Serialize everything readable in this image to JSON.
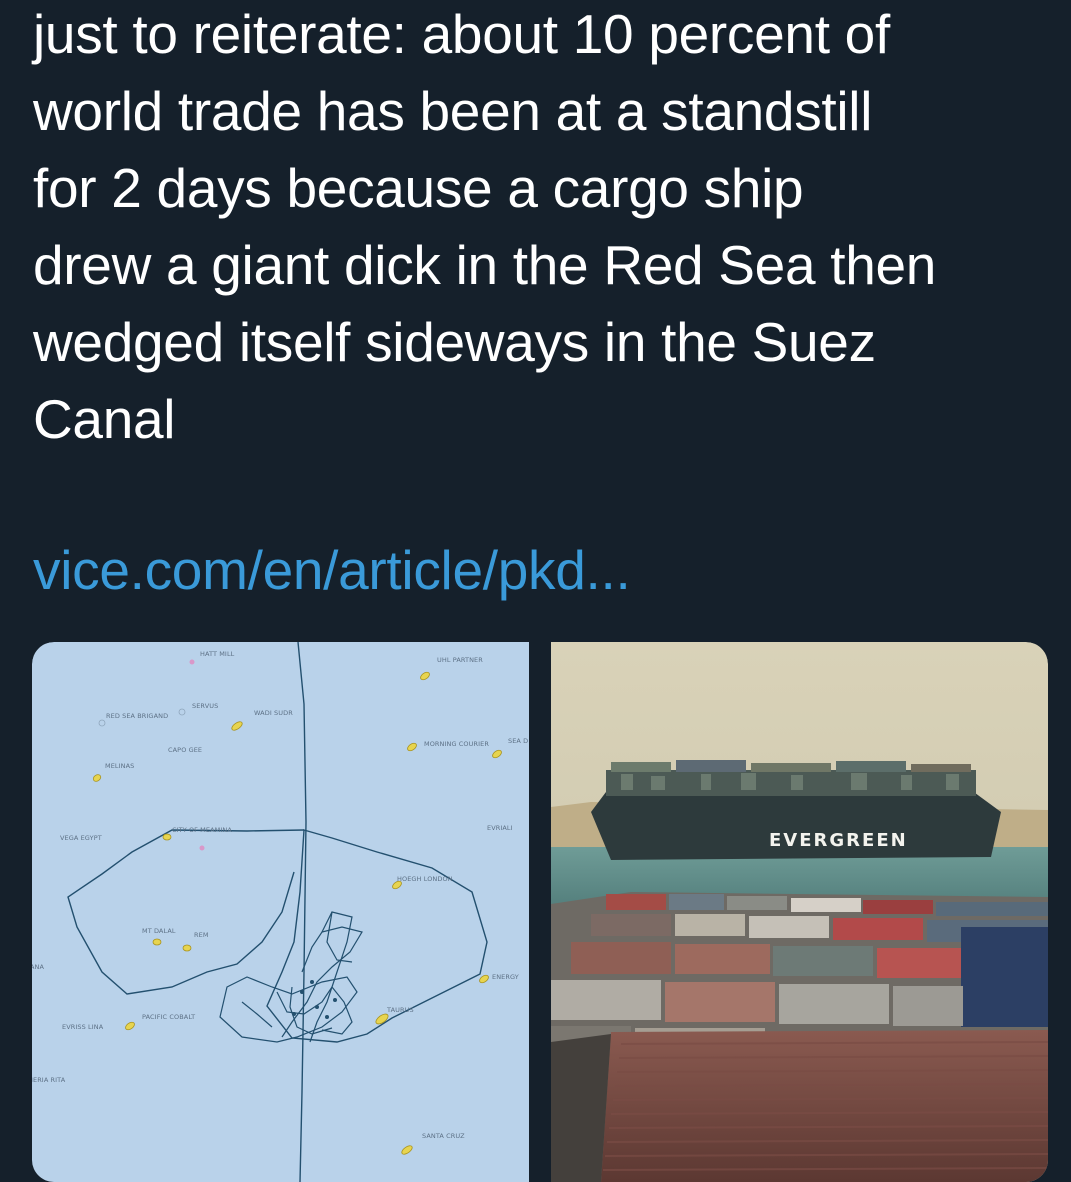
{
  "tweet": {
    "text": "just to reiterate: about 10 percent of\nworld trade has been at a standstill\nfor 2 days because a cargo ship\ndrew a giant dick in the Red Sea then\nwedged itself sideways in the Suez\nCanal",
    "link": "vice.com/en/article/pkd..."
  },
  "map": {
    "labels": [
      "HATT MILL",
      "UHL PARTNER",
      "SERVUS",
      "WADI SUDR",
      "RED SEA BRIGAND",
      "CAPO GEE",
      "MELINAS",
      "MORNING COURIER",
      "SEA D",
      "VEGA EGYPT",
      "CITY OF MEAMINA",
      "EVRIALI",
      "HOEGH LONDON",
      "MT DALAL",
      "REM",
      "ENERGY",
      "PACIFIC COBALT",
      "TAURUS",
      "SANTA CRUZ",
      "EVRISS LINA",
      "ANA",
      "HERIA RITA"
    ]
  },
  "photo": {
    "ship_name": "EVERGREEN"
  },
  "colors": {
    "background": "#15202b",
    "text": "#ffffff",
    "link": "#3a9ad9",
    "map_water": "#b7d1ea",
    "track": "#1f4f73"
  }
}
